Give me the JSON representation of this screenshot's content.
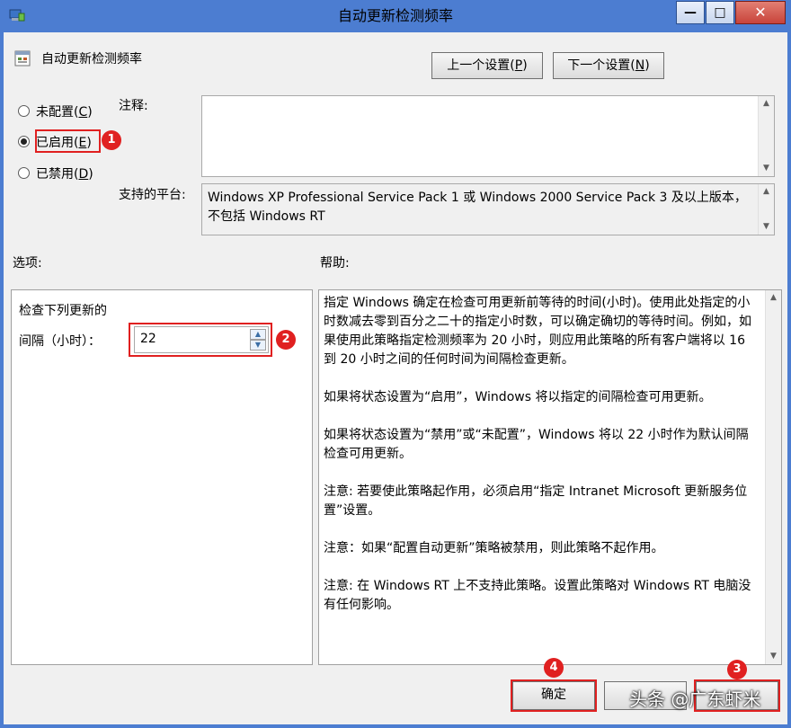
{
  "window": {
    "title": "自动更新检测频率",
    "minimize": "—",
    "maximize": "□",
    "close": "✕"
  },
  "header": {
    "policy_title": "自动更新检测频率",
    "prev_button": "上一个设置(",
    "prev_key": "P",
    "next_button": "下一个设置(",
    "next_key": "N",
    "close_paren": ")"
  },
  "state": {
    "not_configured": "未配置(",
    "not_configured_key": "C",
    "enabled": "已启用(",
    "enabled_key": "E",
    "disabled": "已禁用(",
    "disabled_key": "D",
    "close_paren": ")",
    "selected": "enabled"
  },
  "comment": {
    "label": "注释:",
    "value": ""
  },
  "platform": {
    "label": "支持的平台:",
    "value": "Windows XP Professional Service Pack 1 或 Windows 2000 Service Pack 3 及以上版本，不包括 Windows RT"
  },
  "options": {
    "label": "选项:",
    "line1": "检查下列更新的",
    "interval_label": "间隔（小时）：",
    "interval_value": "22"
  },
  "help": {
    "label": "帮助:",
    "paragraphs": [
      "指定 Windows 确定在检查可用更新前等待的时间(小时)。使用此处指定的小时数减去零到百分之二十的指定小时数，可以确定确切的等待时间。例如，如果使用此策略指定检测频率为 20 小时，则应用此策略的所有客户端将以 16 到 20 小时之间的任何时间为间隔检查更新。",
      "如果将状态设置为“启用”，Windows 将以指定的间隔检查可用更新。",
      "如果将状态设置为“禁用”或“未配置”，Windows 将以 22 小时作为默认间隔检查可用更新。",
      "注意: 若要使此策略起作用，必须启用“指定 Intranet Microsoft 更新服务位置”设置。",
      "注意：如果“配置自动更新”策略被禁用，则此策略不起作用。",
      "注意: 在 Windows RT 上不支持此策略。设置此策略对 Windows RT 电脑没有任何影响。"
    ]
  },
  "footer": {
    "ok_button": "确定",
    "cancel_button": "",
    "apply_button": ""
  },
  "annotations": {
    "badge1": "1",
    "badge2": "2",
    "badge3": "3",
    "badge4": "4",
    "color": "#e02020"
  },
  "watermark": "头条 @广东虾米"
}
